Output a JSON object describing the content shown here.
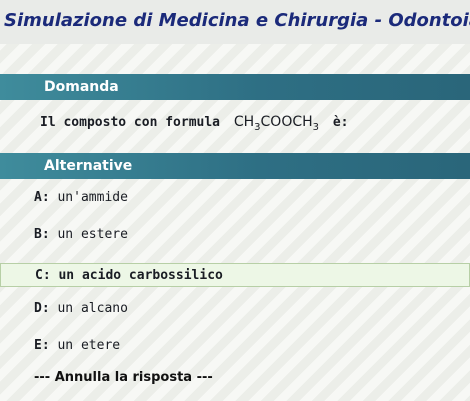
{
  "page": {
    "title": "Simulazione di Medicina e Chirurgia - Odontoiatria e protesi d"
  },
  "question_section": {
    "header": "Domanda",
    "prefix": "Il composto con formula",
    "formula": {
      "p1": "CH",
      "s1": "3",
      "p2": "COOCH",
      "s2": "3"
    },
    "suffix": "è:"
  },
  "answers_section": {
    "header": "Alternative",
    "options": [
      {
        "letter": "A:",
        "text": "un'ammide",
        "selected": false
      },
      {
        "letter": "B:",
        "text": "un estere",
        "selected": false
      },
      {
        "letter": "C:",
        "text": "un acido carbossilico",
        "selected": true
      },
      {
        "letter": "D:",
        "text": "un alcano",
        "selected": false
      },
      {
        "letter": "E:",
        "text": "un etere",
        "selected": false
      }
    ],
    "cancel_label": "--- Annulla la risposta ---"
  }
}
